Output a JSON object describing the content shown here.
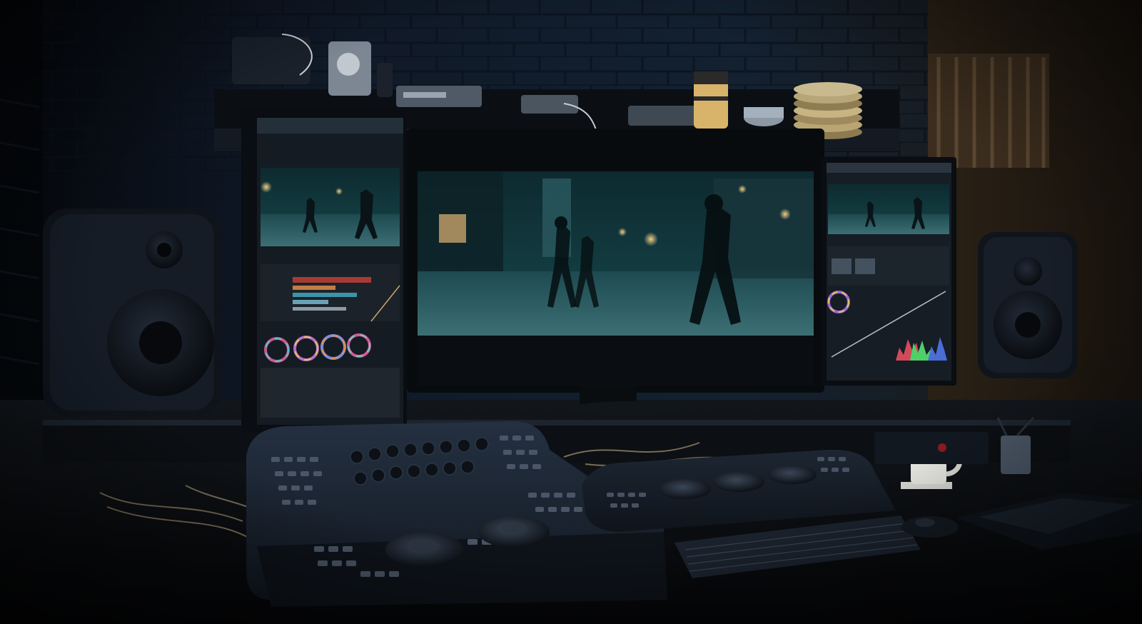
{
  "scene": {
    "palette": {
      "wall": "#101a27",
      "brick_line": "#0a1019",
      "desk": "#0d1014",
      "screen_dark": "#0b1116",
      "teal_highlight": "#3f7f86",
      "warm_light": "#c9a46a",
      "keyboard": "#1c2430"
    }
  },
  "monitors": {
    "center_bezel_text": "",
    "panel_brand_text": ""
  },
  "icons": {
    "left_speaker": "speaker-icon",
    "right_speaker": "speaker-icon",
    "mug": "mug-icon",
    "keyboard": "keyboard-icon",
    "mouse": "mouse-icon"
  }
}
